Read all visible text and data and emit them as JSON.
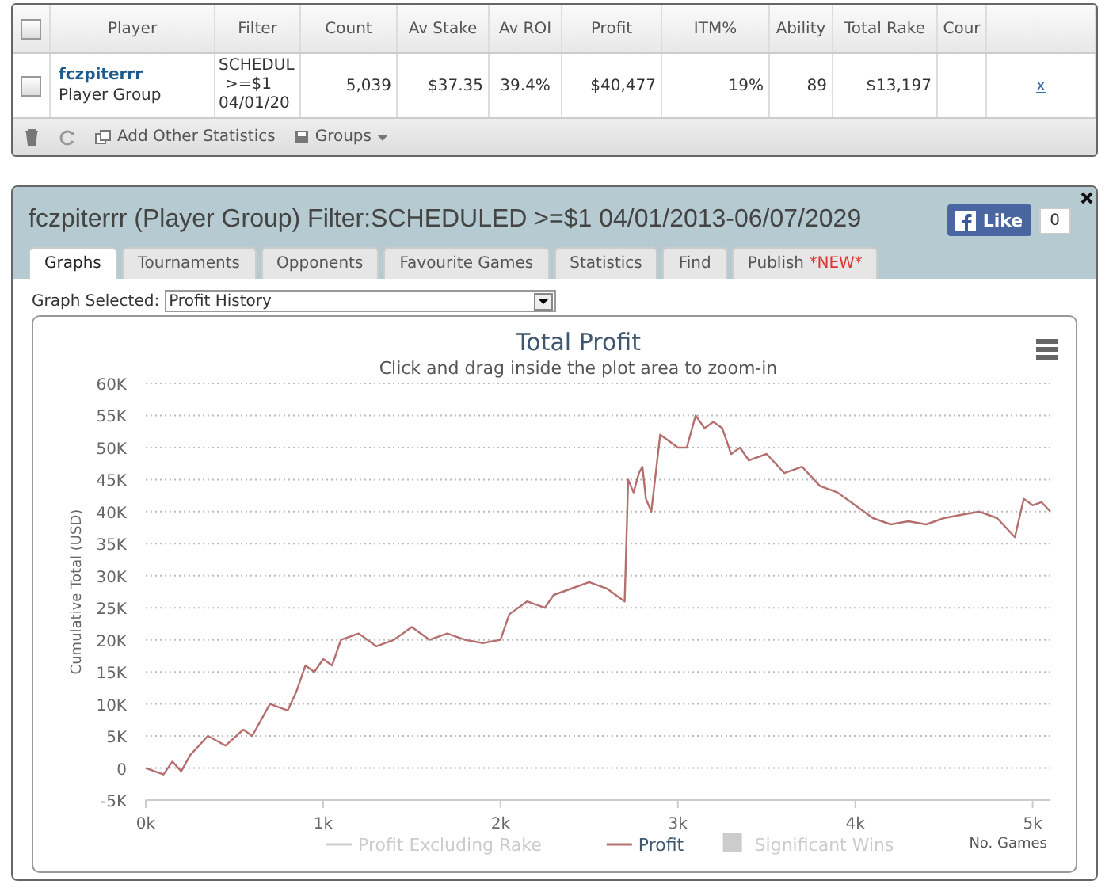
{
  "stats_table": {
    "columns": [
      "Player",
      "Filter",
      "Count",
      "Av Stake",
      "Av ROI",
      "Profit",
      "ITM%",
      "Ability",
      "Total Rake",
      "Cour"
    ],
    "rows": [
      {
        "checked": false,
        "player": "fczpiterrr",
        "player_type": "Player Group",
        "filter_lines": [
          "SCHEDUL",
          ">=$1",
          "04/01/20"
        ],
        "count": "5,039",
        "av_stake": "$37.35",
        "av_roi": "39.4%",
        "profit": "$40,477",
        "itm": "19%",
        "ability": "89",
        "total_rake": "$13,197",
        "remove": "x"
      }
    ],
    "header_checked": false,
    "footer": {
      "add_statistics": "Add Other Statistics",
      "groups": "Groups"
    }
  },
  "panel": {
    "title": "fczpiterrr (Player Group) Filter:SCHEDULED >=$1 04/01/2013-06/07/2029",
    "like": {
      "label": "Like",
      "count": "0"
    },
    "tabs": [
      {
        "label": "Graphs",
        "selected": true
      },
      {
        "label": "Tournaments",
        "selected": false
      },
      {
        "label": "Opponents",
        "selected": false
      },
      {
        "label": "Favourite Games",
        "selected": false
      },
      {
        "label": "Statistics",
        "selected": false
      },
      {
        "label": "Find",
        "selected": false
      },
      {
        "label": "Publish",
        "badge": "*NEW*",
        "selected": false
      }
    ],
    "graph_select": {
      "label": "Graph Selected:",
      "value": "Profit History"
    },
    "chart": {
      "subtitle": "Click and drag inside the plot area to zoom-in",
      "xaxis_note": "No. Games",
      "legend": [
        {
          "label": "Profit Excluding Rake",
          "kind": "line",
          "visible": false
        },
        {
          "kind": "series",
          "visible": true
        },
        {
          "label": "Significant Wins",
          "kind": "area",
          "visible": false
        }
      ],
      "chart_data": {
        "type": "line",
        "grid": true,
        "title": "Total Profit",
        "ylabel": "Cumulative Total (USD)",
        "x": [
          0,
          100,
          150,
          200,
          250,
          350,
          450,
          550,
          600,
          700,
          800,
          850,
          900,
          950,
          1000,
          1050,
          1100,
          1200,
          1300,
          1400,
          1500,
          1600,
          1700,
          1800,
          1900,
          2000,
          2050,
          2150,
          2250,
          2300,
          2400,
          2500,
          2600,
          2700,
          2720,
          2750,
          2780,
          2800,
          2820,
          2850,
          2900,
          2950,
          3000,
          3050,
          3100,
          3150,
          3200,
          3250,
          3300,
          3350,
          3400,
          3500,
          3600,
          3700,
          3800,
          3900,
          4000,
          4100,
          4200,
          4300,
          4400,
          4500,
          4600,
          4700,
          4800,
          4900,
          4950,
          5000,
          5050,
          5100
        ],
        "series": [
          {
            "name": "Profit",
            "color": "#b56f6f",
            "values": [
              0,
              -1000,
              1000,
              -500,
              2000,
              5000,
              3500,
              6000,
              5000,
              10000,
              9000,
              12000,
              16000,
              15000,
              17000,
              16000,
              20000,
              21000,
              19000,
              20000,
              22000,
              20000,
              21000,
              20000,
              19500,
              20000,
              24000,
              26000,
              25000,
              27000,
              28000,
              29000,
              28000,
              26000,
              45000,
              43000,
              46000,
              47000,
              42000,
              40000,
              52000,
              51000,
              50000,
              50000,
              55000,
              53000,
              54000,
              53000,
              49000,
              50000,
              48000,
              49000,
              46000,
              47000,
              44000,
              43000,
              41000,
              39000,
              38000,
              38500,
              38000,
              39000,
              39500,
              40000,
              39000,
              36000,
              42000,
              41000,
              41500,
              40000
            ]
          }
        ],
        "xlim": [
          0,
          5100
        ],
        "ylim": [
          -5000,
          60000
        ],
        "xticks": [
          {
            "value": 0,
            "label": "0k"
          },
          {
            "value": 1000,
            "label": "1k"
          },
          {
            "value": 2000,
            "label": "2k"
          },
          {
            "value": 3000,
            "label": "3k"
          },
          {
            "value": 4000,
            "label": "4k"
          },
          {
            "value": 5000,
            "label": "5k"
          }
        ],
        "yticks": [
          {
            "value": -5000,
            "label": "-5K"
          },
          {
            "value": 0,
            "label": "0"
          },
          {
            "value": 5000,
            "label": "5K"
          },
          {
            "value": 10000,
            "label": "10K"
          },
          {
            "value": 15000,
            "label": "15K"
          },
          {
            "value": 20000,
            "label": "20K"
          },
          {
            "value": 25000,
            "label": "25K"
          },
          {
            "value": 30000,
            "label": "30K"
          },
          {
            "value": 35000,
            "label": "35K"
          },
          {
            "value": 40000,
            "label": "40K"
          },
          {
            "value": 45000,
            "label": "45K"
          },
          {
            "value": 50000,
            "label": "50K"
          },
          {
            "value": 55000,
            "label": "55K"
          },
          {
            "value": 60000,
            "label": "60K"
          }
        ]
      }
    }
  }
}
